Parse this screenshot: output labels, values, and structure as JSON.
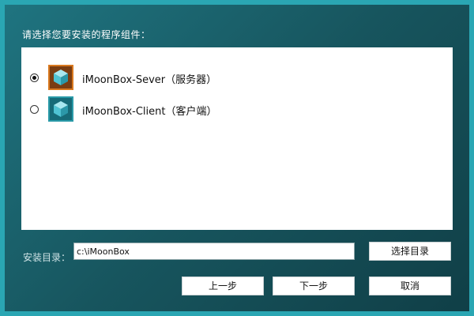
{
  "installer": {
    "prompt": "请选择您要安装的程序组件：",
    "components": [
      {
        "label": "iMoonBox-Sever（服务器）",
        "selected": true,
        "icon": "cube-icon",
        "icon_color": "#d9791f"
      },
      {
        "label": "iMoonBox-Client（客户端）",
        "selected": false,
        "icon": "cube-icon",
        "icon_color": "#2a9aa8"
      }
    ],
    "install_dir": {
      "label": "安装目录：",
      "value": "c:\\iMoonBox",
      "browse_label": "选择目录"
    },
    "buttons": {
      "back": "上一步",
      "next": "下一步",
      "cancel": "取消"
    }
  },
  "colors": {
    "frame": "#2aa6b3",
    "background": "#1a5f69",
    "server_accent": "#d9791f",
    "client_accent": "#2a9aa8"
  }
}
